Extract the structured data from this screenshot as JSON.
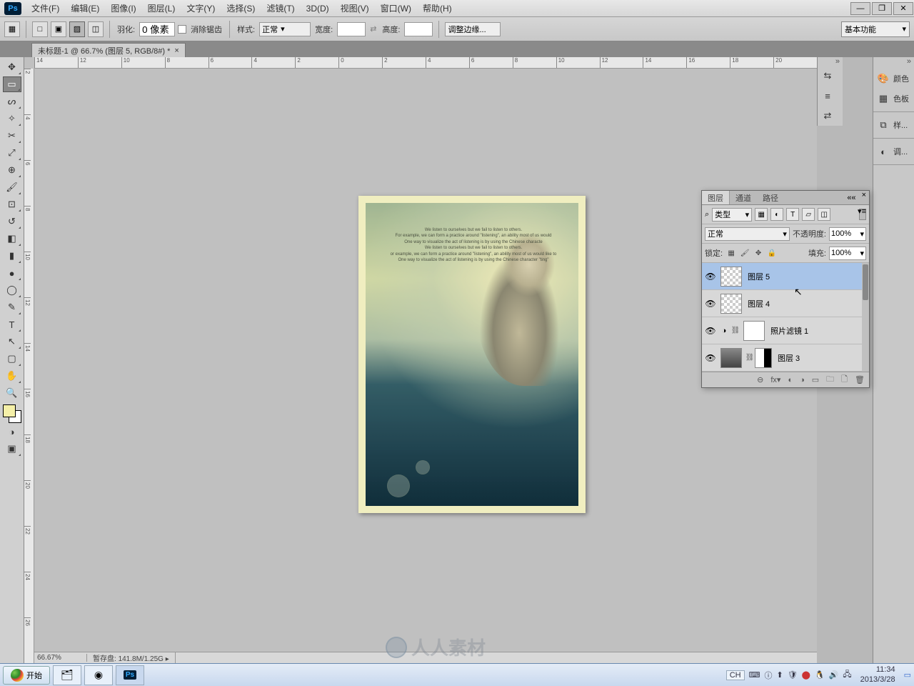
{
  "menubar": [
    "文件(F)",
    "编辑(E)",
    "图像(I)",
    "图层(L)",
    "文字(Y)",
    "选择(S)",
    "滤镜(T)",
    "3D(D)",
    "视图(V)",
    "窗口(W)",
    "帮助(H)"
  ],
  "window_controls": {
    "min": "—",
    "max": "❐",
    "close": "✕"
  },
  "options": {
    "feather_label": "羽化:",
    "feather_value": "0 像素",
    "antialias_label": "消除锯齿",
    "style_label": "样式:",
    "style_value": "正常",
    "width_label": "宽度:",
    "height_label": "高度:",
    "refine_edge": "调整边缘...",
    "workspace": "基本功能"
  },
  "document_tab": "未标题-1 @ 66.7% (图层 5, RGB/8#) *",
  "ruler_h": [
    "14",
    "12",
    "10",
    "8",
    "6",
    "4",
    "2",
    "0",
    "2",
    "4",
    "6",
    "8",
    "10",
    "12",
    "14",
    "16",
    "18",
    "20"
  ],
  "ruler_v": [
    "2",
    "4",
    "6",
    "8",
    "10",
    "12",
    "14",
    "16",
    "18",
    "20",
    "22",
    "24",
    "26"
  ],
  "right_panels": {
    "color": "颜色",
    "swatches": "色板",
    "styles": "样...",
    "adjust": "调..."
  },
  "layers_panel": {
    "tabs": [
      "图层",
      "通道",
      "路径"
    ],
    "filter_label": "类型",
    "blend_mode": "正常",
    "opacity_label": "不透明度:",
    "opacity_value": "100%",
    "lock_label": "锁定:",
    "fill_label": "填充:",
    "fill_value": "100%",
    "layers": [
      {
        "name": "图层 5",
        "selected": true,
        "type": "raster"
      },
      {
        "name": "图层 4",
        "selected": false,
        "type": "raster"
      },
      {
        "name": "照片滤镜 1",
        "selected": false,
        "type": "adjustment"
      },
      {
        "name": "图层 3",
        "selected": false,
        "type": "masked"
      }
    ],
    "bottom_icons": [
      "⊖",
      "fx▾",
      "◐",
      "◑",
      "▭",
      "🗀",
      "🗋",
      "🗑"
    ]
  },
  "status": {
    "zoom": "66.67%",
    "scratch_label": "暂存盘:",
    "scratch_value": "141.8M/1.25G"
  },
  "taskbar": {
    "start": "开始",
    "lang": "CH",
    "time": "11:34",
    "date": "2013/3/28"
  },
  "artwork_text": [
    "We listen to ourselves but we fail to listen to others.",
    "For example, we can form a practice around \"listening\", an ability most of us would",
    "One way to visualize the act of listening is by using the Chinese characte",
    "We listen to ourselves but we fail to listen to others.",
    "or example, we can form a practice around \"listening\", an ability most of us would like to",
    "One way to visualize the act of listening is by using the Chinese character \"ting\""
  ],
  "watermark": "人人素材"
}
